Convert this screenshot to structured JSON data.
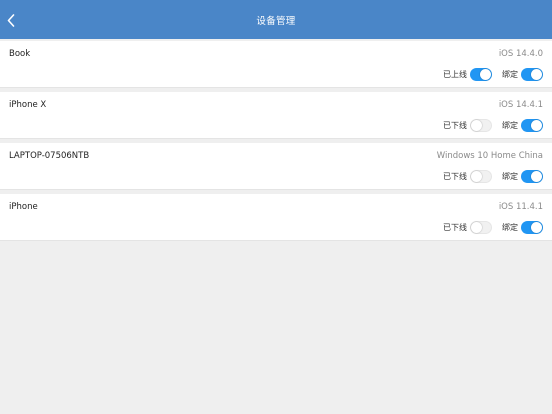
{
  "nav": {
    "title": "设备管理",
    "back_icon": "chevron-left-icon",
    "bar_color": "#4a86c8"
  },
  "accent_color": "#2196f3",
  "devices": [
    {
      "name": "Book",
      "os": "iOS 14.4.0",
      "status_label": "已上线",
      "status_on": true,
      "bind_label": "绑定",
      "bind_on": true
    },
    {
      "name": "iPhone X",
      "os": "iOS 14.4.1",
      "status_label": "已下线",
      "status_on": false,
      "bind_label": "绑定",
      "bind_on": true
    },
    {
      "name": "LAPTOP-07506NTB",
      "os": "Windows 10 Home China",
      "status_label": "已下线",
      "status_on": false,
      "bind_label": "绑定",
      "bind_on": true
    },
    {
      "name": "iPhone",
      "os": "iOS 11.4.1",
      "status_label": "已下线",
      "status_on": false,
      "bind_label": "绑定",
      "bind_on": true
    }
  ]
}
